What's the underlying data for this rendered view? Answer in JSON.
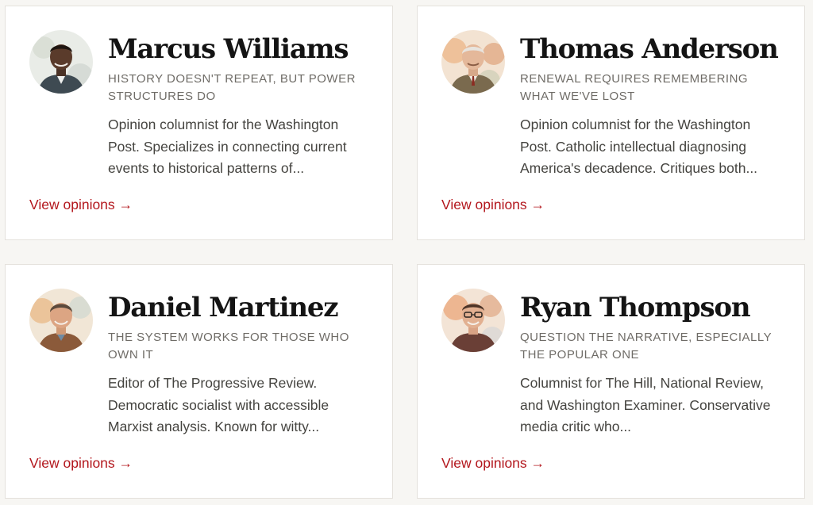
{
  "columnists": [
    {
      "name": "Marcus Williams",
      "tagline": "History doesn't repeat, but power structures do",
      "bio": "Opinion columnist for the Washington Post. Specializes in connecting current events to historical patterns of...",
      "link_label": "View opinions →"
    },
    {
      "name": "Thomas Anderson",
      "tagline": "Renewal requires remembering what we've lost",
      "bio": "Opinion columnist for the Washington Post. Catholic intellectual diagnosing America's decadence. Critiques both...",
      "link_label": "View opinions →"
    },
    {
      "name": "Daniel Martinez",
      "tagline": "The system works for those who own it",
      "bio": "Editor of The Progressive Review. Democratic socialist with accessible Marxist analysis. Known for witty...",
      "link_label": "View opinions →"
    },
    {
      "name": "Ryan Thompson",
      "tagline": "Question the narrative, especially the popular one",
      "bio": "Columnist for The Hill, National Review, and Washington Examiner. Conservative media critic who...",
      "link_label": "View opinions →"
    }
  ],
  "colors": {
    "page_background": "#f7f6f3",
    "card_background": "#ffffff",
    "card_border": "#e4e1dc",
    "name_text": "#141414",
    "tagline_text": "#6f6c67",
    "bio_text": "#454440",
    "link_accent": "#b3171d"
  }
}
